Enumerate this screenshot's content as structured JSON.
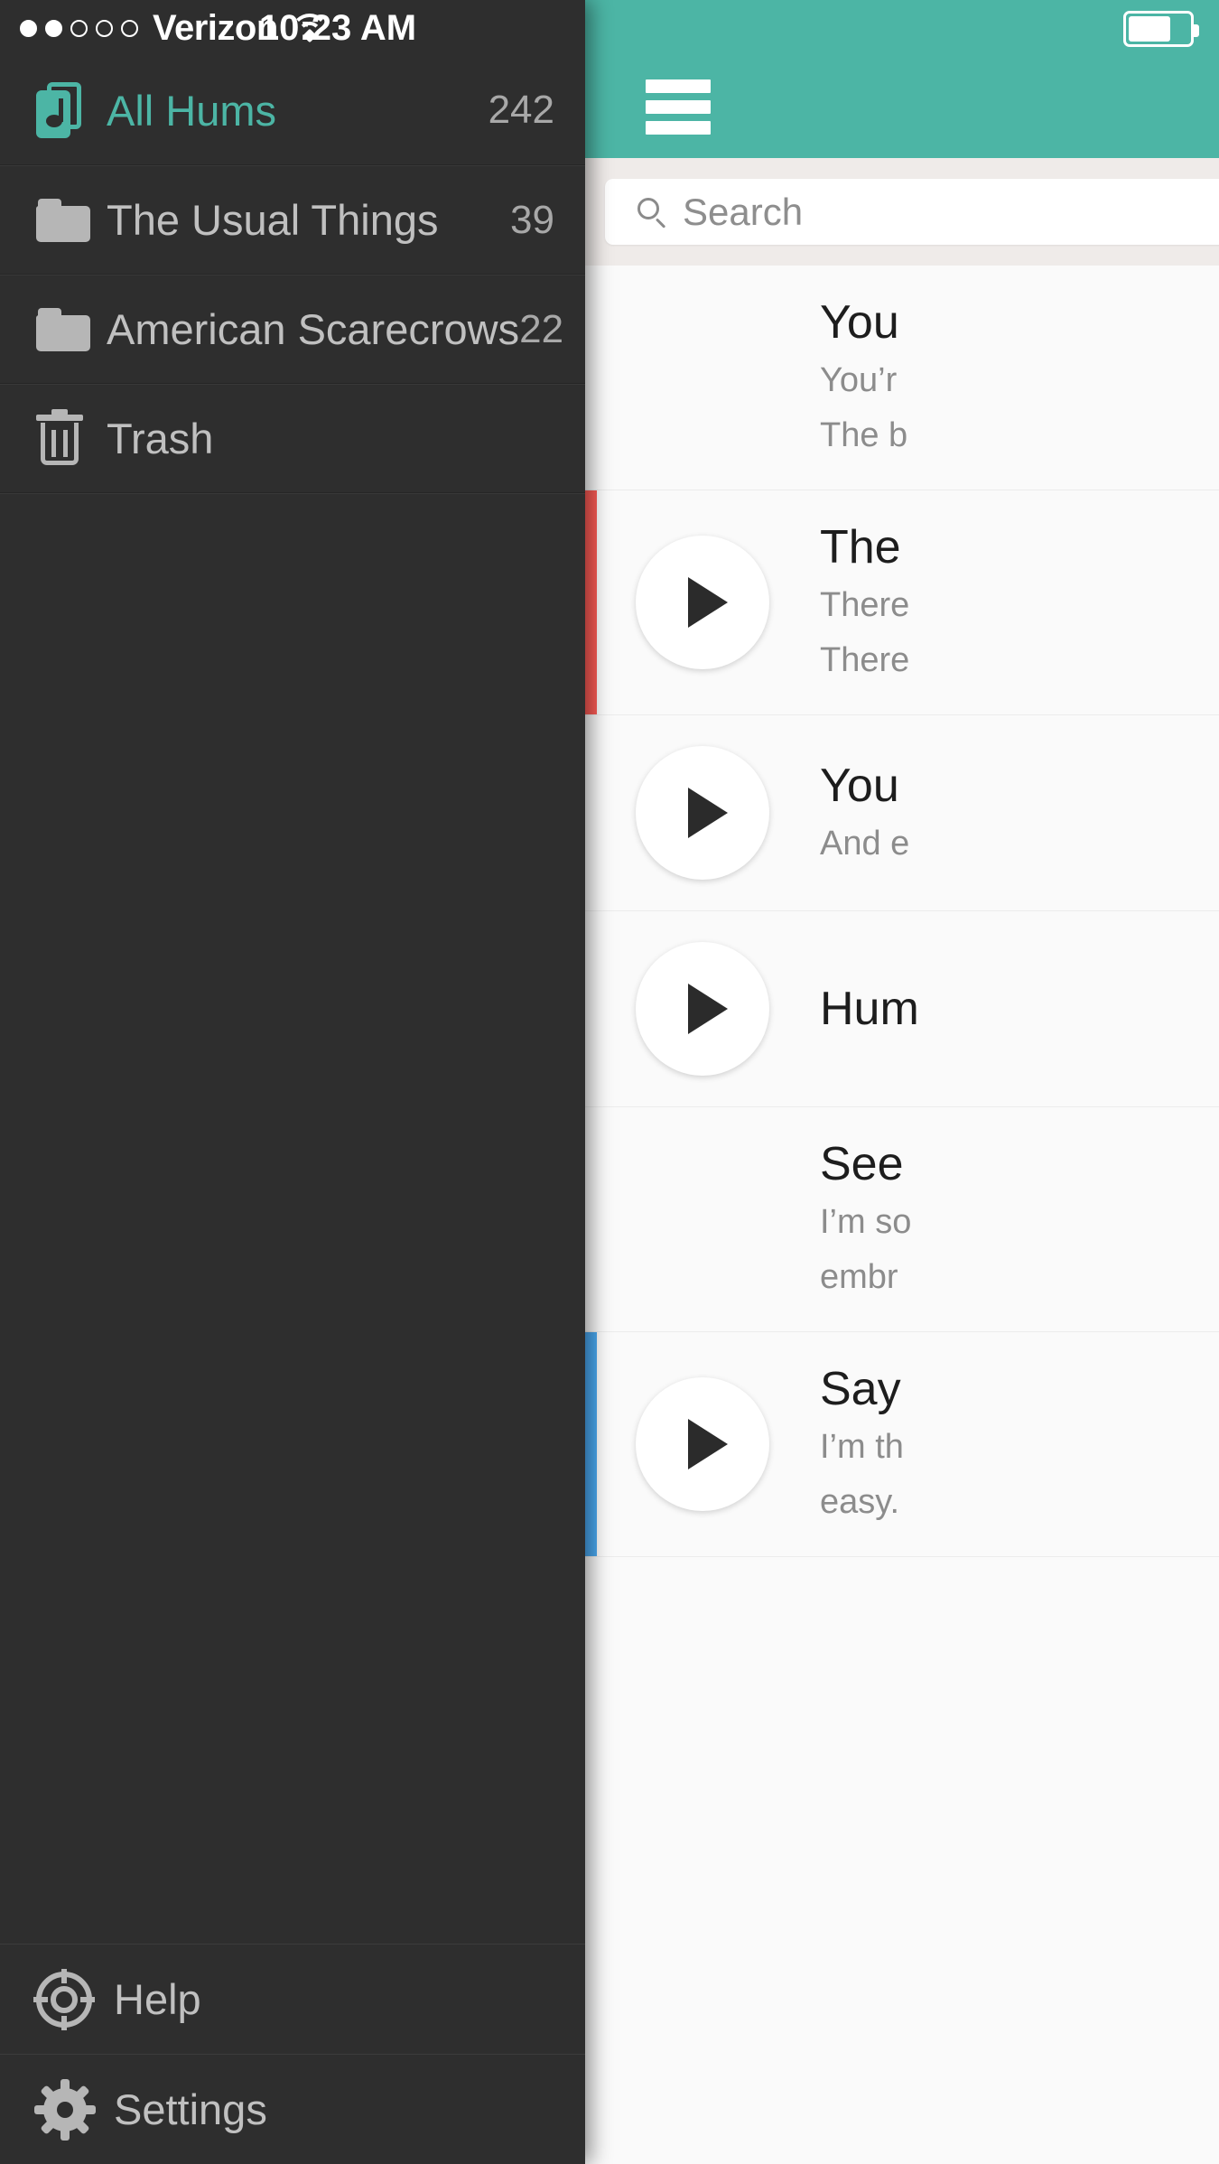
{
  "status_bar": {
    "carrier": "Verizon",
    "time": "10:23 AM",
    "signal_dots_total": 5,
    "signal_dots_filled": 2,
    "wifi_icon": "wifi-icon"
  },
  "sidebar": {
    "all_hums": {
      "label": "All Hums",
      "count": "242",
      "icon": "hums-stack-icon"
    },
    "folders": [
      {
        "label": "The Usual Things",
        "count": "39",
        "icon": "folder-icon"
      },
      {
        "label": "American Scarecrows",
        "count": "22",
        "icon": "folder-icon"
      }
    ],
    "trash": {
      "label": "Trash",
      "count": "",
      "icon": "trash-icon"
    },
    "footer": [
      {
        "label": "Help",
        "icon": "help-icon"
      },
      {
        "label": "Settings",
        "icon": "gear-icon"
      }
    ]
  },
  "content": {
    "battery_icon": "battery-icon",
    "menu_icon": "hamburger-menu-icon",
    "header_color": "#4cb5a5",
    "search": {
      "placeholder": "Search",
      "value": "",
      "icon": "search-icon"
    },
    "hums": [
      {
        "title": "You",
        "lines": [
          "You’r",
          "The b"
        ],
        "accent": "",
        "has_play": false
      },
      {
        "title": "The",
        "lines": [
          "There",
          "There"
        ],
        "accent": "#fb5b55",
        "has_play": true
      },
      {
        "title": "You",
        "lines": [
          "And e"
        ],
        "accent": "",
        "has_play": true
      },
      {
        "title": "Hum",
        "lines": [],
        "accent": "",
        "has_play": true
      },
      {
        "title": "See",
        "lines": [
          "I’m so",
          "embr"
        ],
        "accent": "",
        "has_play": false
      },
      {
        "title": "Say",
        "lines": [
          "I’m th",
          "easy."
        ],
        "accent": "#4aa8f0",
        "has_play": true
      }
    ]
  }
}
